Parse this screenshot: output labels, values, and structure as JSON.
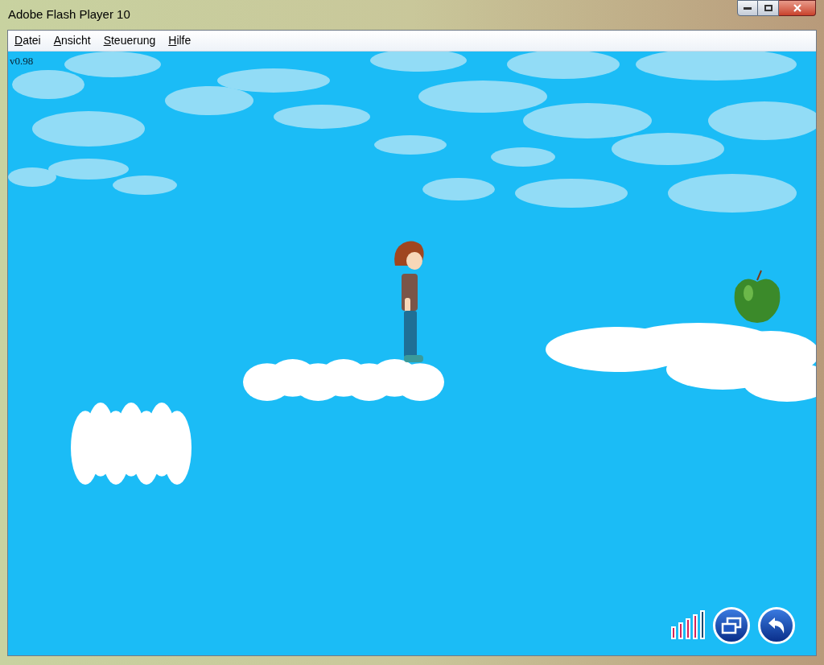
{
  "window": {
    "title": "Adobe Flash Player 10"
  },
  "menu": [
    "Datei",
    "Ansicht",
    "Steuerung",
    "Hilfe"
  ],
  "game": {
    "version": "v0.98",
    "quality": {
      "level": 0.8
    }
  }
}
